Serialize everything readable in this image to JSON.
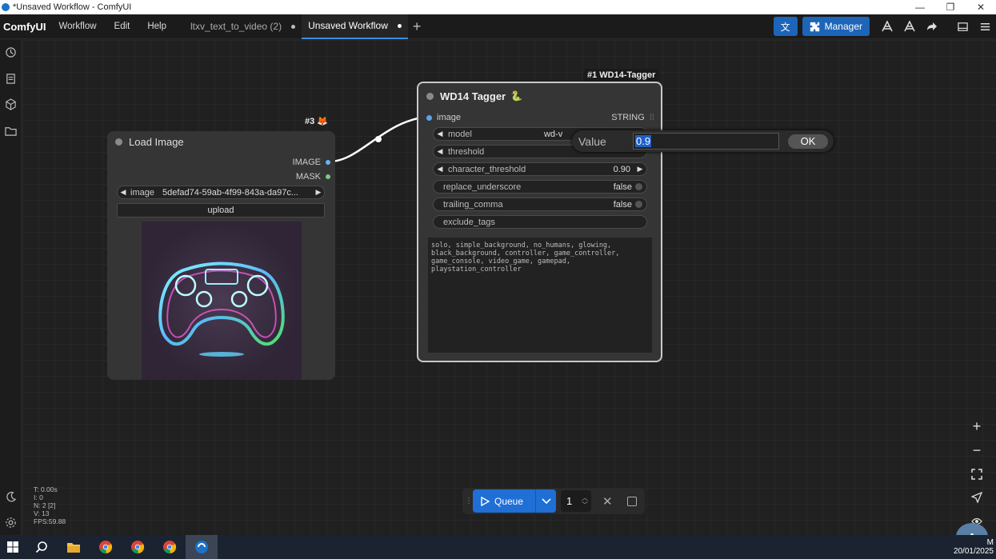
{
  "window": {
    "title": "*Unsaved Workflow - ComfyUI",
    "controls": [
      "—",
      "❐",
      "✕"
    ]
  },
  "menubar": {
    "brand": "ComfyUI",
    "menus": [
      "Workflow",
      "Edit",
      "Help"
    ],
    "tabs": [
      {
        "label": "ltxv_text_to_video (2)",
        "active": false
      },
      {
        "label": "Unsaved Workflow",
        "active": true
      }
    ],
    "manager_label": "Manager"
  },
  "nodes": {
    "load_image": {
      "badge": "#3",
      "title": "Load Image",
      "outputs": [
        {
          "label": "IMAGE",
          "color": "#64b5f6"
        },
        {
          "label": "MASK",
          "color": "#81c784"
        }
      ],
      "image_widget_label": "image",
      "image_widget_value": "5defad74-59ab-4f99-843a-da97c...",
      "upload_label": "upload"
    },
    "wd14_tagger": {
      "badge": "#1 WD14-Tagger",
      "title": "WD14 Tagger",
      "input_label": "image",
      "output_label": "STRING",
      "widgets": [
        {
          "label": "model",
          "value": "wd-v",
          "type": "combo"
        },
        {
          "label": "threshold",
          "value": "",
          "type": "number"
        },
        {
          "label": "character_threshold",
          "value": "0.90",
          "type": "number"
        },
        {
          "label": "replace_underscore",
          "value": "false",
          "type": "toggle"
        },
        {
          "label": "trailing_comma",
          "value": "false",
          "type": "toggle"
        },
        {
          "label": "exclude_tags",
          "value": "",
          "type": "text"
        }
      ],
      "output_text": "solo, simple_background, no_humans, glowing,\nblack_background, controller, game_controller,\ngame_console, video_game, gamepad,\nplaystation_controller"
    }
  },
  "prompt": {
    "label": "Value",
    "value": "0.9",
    "ok_label": "OK"
  },
  "queue": {
    "label": "Queue",
    "count": "1"
  },
  "stats": [
    "T: 0.00s",
    "I: 0",
    "N: 2 [2]",
    "V: 13",
    "FPS:59.88"
  ],
  "taskbar": {
    "time": "M",
    "date": "20/01/2025"
  },
  "colors": {
    "accent": "#1f6fd6",
    "link": "#ffffff",
    "image_port": "#64b5f6",
    "mask_port": "#81c784"
  }
}
